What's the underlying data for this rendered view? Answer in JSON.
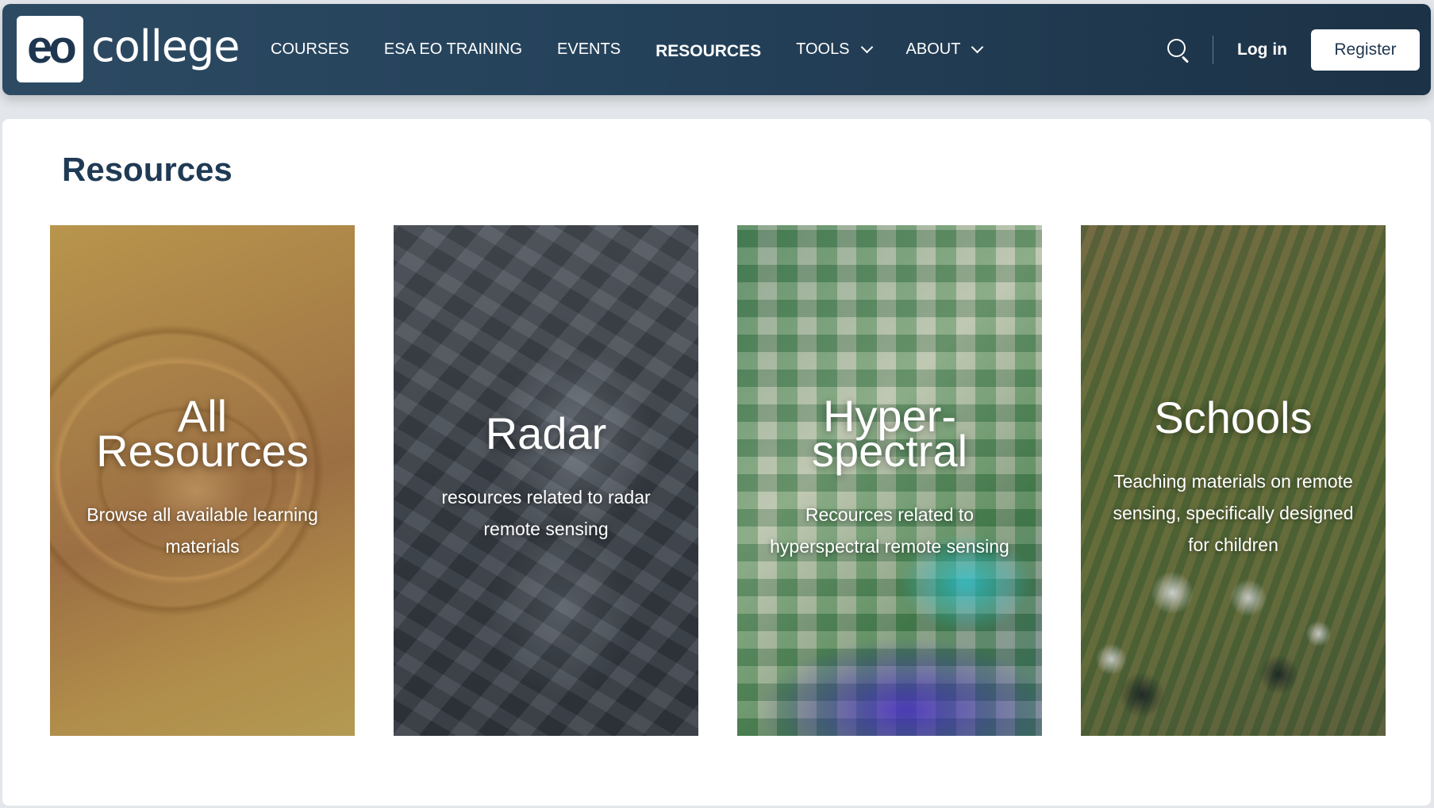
{
  "header": {
    "logo_mark": "eo",
    "logo_word": "college",
    "nav": [
      {
        "label": "COURSES"
      },
      {
        "label": "ESA EO TRAINING"
      },
      {
        "label": "EVENTS"
      },
      {
        "label": "RESOURCES",
        "active": true
      },
      {
        "label": "TOOLS",
        "dropdown": true
      },
      {
        "label": "ABOUT",
        "dropdown": true
      }
    ],
    "login_label": "Log in",
    "register_label": "Register"
  },
  "main": {
    "title": "Resources",
    "tiles": [
      {
        "title": "All\nResources",
        "description": "Browse all available learning materials"
      },
      {
        "title": "Radar",
        "description": "resources related to radar remote sensing"
      },
      {
        "title": "Hyper-\nspectral",
        "description": "Recources related to hyperspectral remote sensing"
      },
      {
        "title": "Schools",
        "description": "Teaching materials on remote sensing, specifically designed for children"
      }
    ]
  },
  "icons": {
    "search": "search-icon",
    "dropdown": "chevron-down-icon"
  }
}
